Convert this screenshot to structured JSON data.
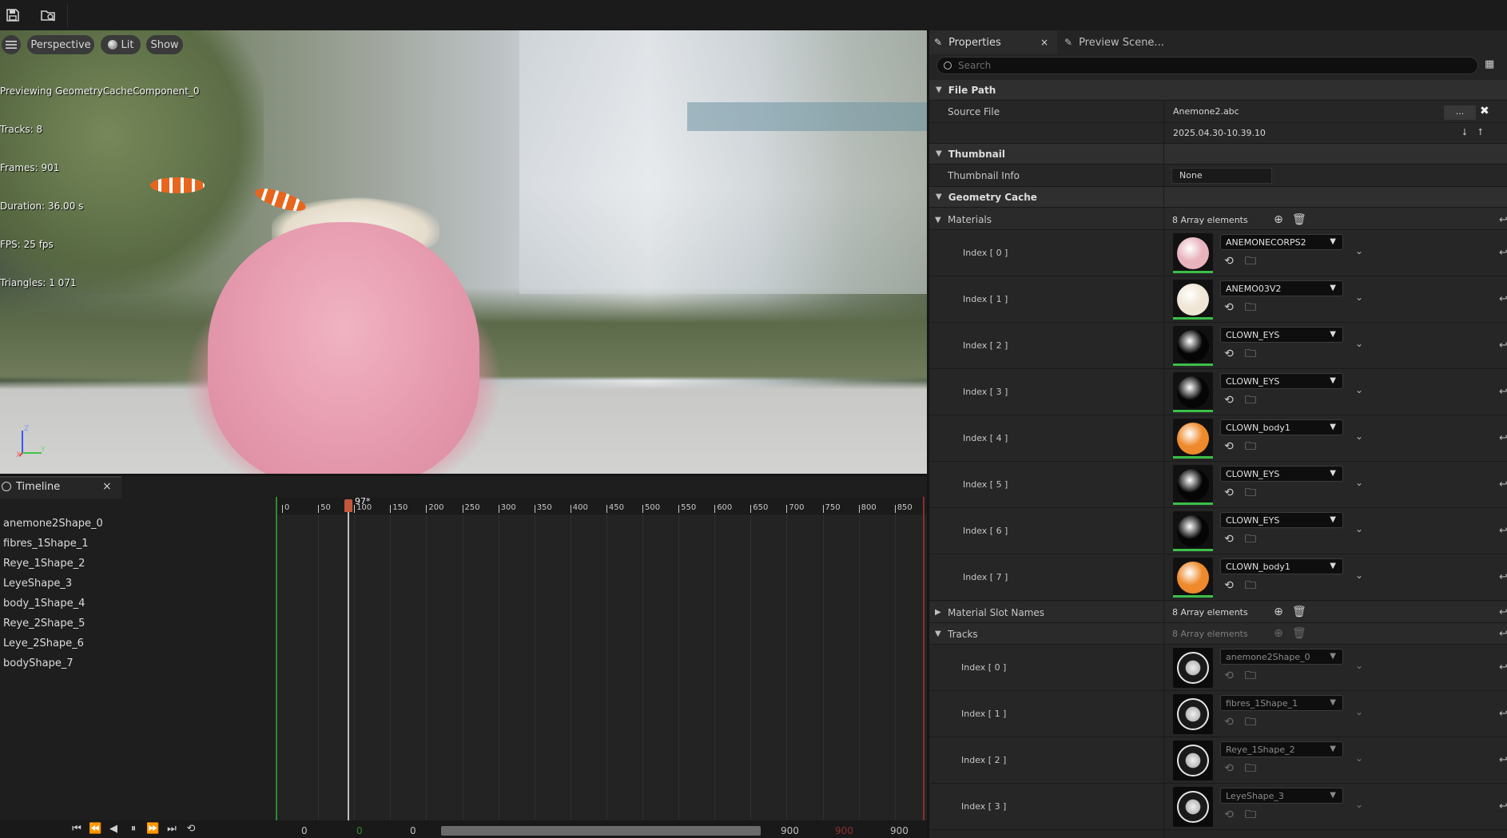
{
  "toolbar": {
    "save_icon": "save-icon",
    "browse_icon": "browse-asset-icon"
  },
  "viewport": {
    "menu_icon": "hamburger-menu-icon",
    "perspective_label": "Perspective",
    "lit_label": "Lit",
    "show_label": "Show",
    "info": [
      "Previewing GeometryCacheComponent_0",
      "Tracks: 8",
      "Frames: 901",
      "Duration: 36.00 s",
      "FPS: 25 fps",
      "Triangles: 1 071"
    ],
    "axis_x": "X",
    "axis_y": "Y",
    "axis_z": "Z"
  },
  "timeline": {
    "tab_label": "Timeline",
    "close": "×",
    "tracks": [
      "anemone2Shape_0",
      "fibres_1Shape_1",
      "Reye_1Shape_2",
      "LeyeShape_3",
      "body_1Shape_4",
      "Reye_2Shape_5",
      "Leye_2Shape_6",
      "bodyShape_7"
    ],
    "ruler_labels": [
      "0",
      "50",
      "100",
      "150",
      "200",
      "250",
      "300",
      "350",
      "400",
      "450",
      "500",
      "550",
      "600",
      "650",
      "700",
      "750",
      "800",
      "850"
    ],
    "current_frame": "97*",
    "range": {
      "start": "0",
      "start_green": "0",
      "view_start": "0",
      "view_end": "900",
      "end_red": "900",
      "end": "900"
    }
  },
  "panel": {
    "tab_properties": "Properties",
    "tab_close": "×",
    "tab_preview": "Preview Scene...",
    "search_placeholder": "Search",
    "sections": {
      "file_path": "File Path",
      "thumbnail": "Thumbnail",
      "geometry_cache": "Geometry Cache",
      "materials": "Materials",
      "material_slot_names": "Material Slot Names",
      "tracks": "Tracks"
    },
    "source_file_label": "Source File",
    "source_file_value": "Anemone2.abc",
    "browse_btn": "...",
    "timestamp": "2025.04.30-10.39.10",
    "thumbnail_info_label": "Thumbnail Info",
    "thumbnail_info_value": "None",
    "materials_count": "8 Array elements",
    "slot_names_count": "8 Array elements",
    "tracks_count": "8 Array elements",
    "materials": [
      {
        "index": "Index [ 0 ]",
        "name": "ANEMONECORPS2",
        "color": "#e8b3bd"
      },
      {
        "index": "Index [ 1 ]",
        "name": "ANEMO03V2",
        "color": "#f0e6d6"
      },
      {
        "index": "Index [ 2 ]",
        "name": "CLOWN_EYS",
        "color": "#050505"
      },
      {
        "index": "Index [ 3 ]",
        "name": "CLOWN_EYS",
        "color": "#050505"
      },
      {
        "index": "Index [ 4 ]",
        "name": "CLOWN_body1",
        "color": "#ee8a2b"
      },
      {
        "index": "Index [ 5 ]",
        "name": "CLOWN_EYS",
        "color": "#050505"
      },
      {
        "index": "Index [ 6 ]",
        "name": "CLOWN_EYS",
        "color": "#050505"
      },
      {
        "index": "Index [ 7 ]",
        "name": "CLOWN_body1",
        "color": "#ee8a2b"
      }
    ],
    "track_items": [
      {
        "index": "Index [ 0 ]",
        "name": "anemone2Shape_0"
      },
      {
        "index": "Index [ 1 ]",
        "name": "fibres_1Shape_1"
      },
      {
        "index": "Index [ 2 ]",
        "name": "Reye_1Shape_2"
      },
      {
        "index": "Index [ 3 ]",
        "name": "LeyeShape_3"
      }
    ]
  }
}
